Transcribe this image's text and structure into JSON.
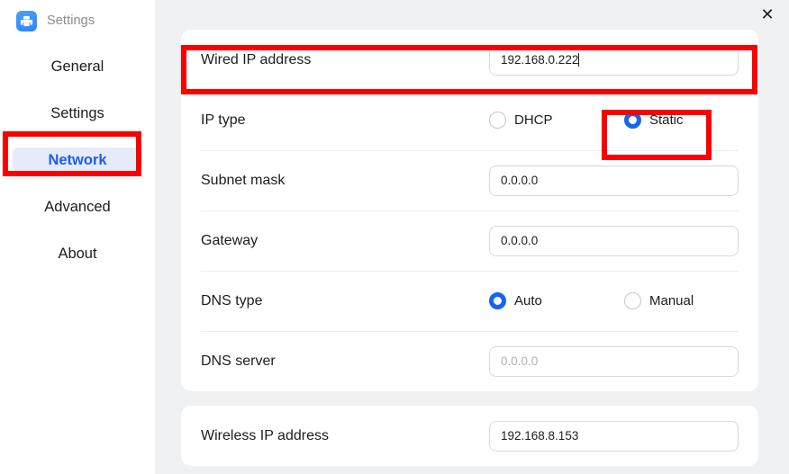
{
  "app": {
    "title": "Settings",
    "icon": "printer-icon",
    "close_icon": "close-icon",
    "accent_color": "#1565f0",
    "annotation_color": "#fb0000",
    "active_nav_bg": "#e6ebf9"
  },
  "sidebar": {
    "items": [
      {
        "label": "General",
        "active": false
      },
      {
        "label": "Settings",
        "active": false
      },
      {
        "label": "Network",
        "active": true
      },
      {
        "label": "Advanced",
        "active": false
      },
      {
        "label": "About",
        "active": false
      }
    ]
  },
  "main": {
    "wired_card": {
      "wired_ip": {
        "label": "Wired IP address",
        "value": "192.168.0.222",
        "has_caret": true
      },
      "ip_type": {
        "label": "IP type",
        "options": [
          {
            "label": "DHCP",
            "selected": false
          },
          {
            "label": "Static",
            "selected": true
          }
        ]
      },
      "subnet_mask": {
        "label": "Subnet mask",
        "value": "0.0.0.0",
        "muted": false
      },
      "gateway": {
        "label": "Gateway",
        "value": "0.0.0.0",
        "muted": false
      },
      "dns_type": {
        "label": "DNS type",
        "options": [
          {
            "label": "Auto",
            "selected": true
          },
          {
            "label": "Manual",
            "selected": false
          }
        ]
      },
      "dns_server": {
        "label": "DNS server",
        "value": "0.0.0.0",
        "muted": true
      }
    },
    "wireless_card": {
      "wireless_ip": {
        "label": "Wireless IP address",
        "value": "192.168.8.153"
      }
    }
  }
}
